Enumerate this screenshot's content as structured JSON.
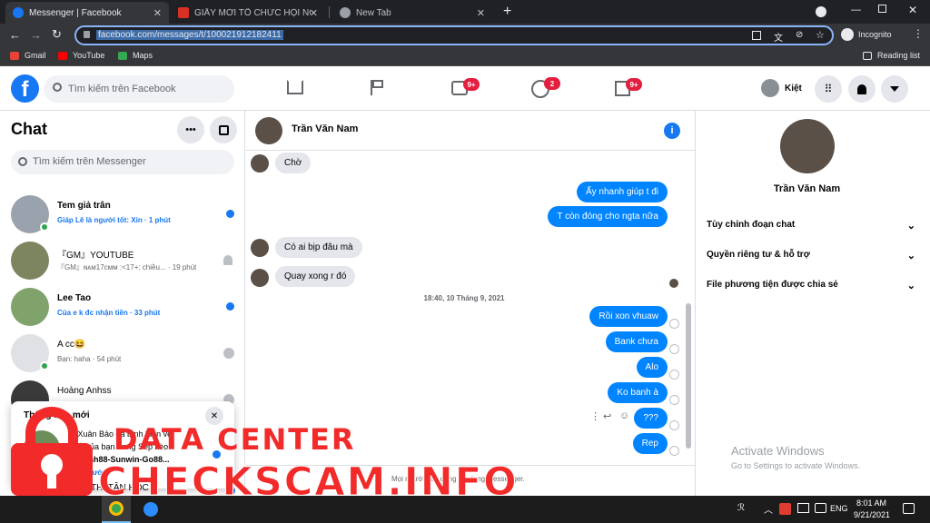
{
  "browser": {
    "tabs": [
      {
        "title": "Messenger | Facebook",
        "fav_color": "#1877f2"
      },
      {
        "title": "GIẤY MỜI TỔ CHỨC HỘI NGHỊ T...",
        "fav_color": "#d93025"
      },
      {
        "title": "New Tab",
        "fav_color": "#9aa0a6"
      }
    ],
    "url": "facebook.com/messages/t/100021912182411",
    "incognito_label": "Incognito",
    "bookmarks": [
      "Gmail",
      "YouTube",
      "Maps"
    ],
    "reading_list": "Reading list"
  },
  "fb": {
    "search_placeholder": "Tìm kiếm trên Facebook",
    "badges": {
      "watch": "9+",
      "groups": "2",
      "gaming": "9+"
    },
    "user_name": "Kiệt"
  },
  "chats": {
    "title": "Chat",
    "search_placeholder": "Tìm kiếm trên Messenger",
    "conversations": [
      {
        "name": "Tem giả trân",
        "preview": "Giáp Lê là người tốt: Xin · 1 phút",
        "unread": true
      },
      {
        "name": "『GM』YOUTUBE",
        "preview": "『GM』ɴᴀᴍ17ᴄᴍᴍ :<17+: chiều... · 19 phút",
        "unread": false
      },
      {
        "name": "Lee Tao",
        "preview": "Của e k đc nhận tiền · 33 phút",
        "unread": true
      },
      {
        "name": "A cc😆",
        "preview": "Bạn: haha · 54 phút",
        "unread": false
      },
      {
        "name": "Hoàng Anhss",
        "preview": "",
        "unread": false
      }
    ],
    "notification": {
      "title": "Thông báo mới",
      "line1": "6.Xuân Bảo đã bình luận về",
      "line2": "viết của bạn trong Sếp kèo",
      "line3": "...(Binh88-Sunwin-Go88...",
      "time": "...ày trước"
    },
    "last_item_partial": "THI TÂN HỌC"
  },
  "chat": {
    "contact_name": "Trần Văn Nam",
    "timestamp": "18:40, 10 Tháng 9, 2021",
    "messages_in": [
      "Chờ",
      "Có ai bịp đâu mà",
      "Quay xong r đó"
    ],
    "messages_out_before": [
      "Ấy nhanh giúp t đi",
      "T còn đóng cho ngta nữa"
    ],
    "messages_out_after": [
      "Rồi xon vhuaw",
      "Bank chưa",
      "Alo",
      "Ko banh à",
      "???",
      "Rep"
    ],
    "footer_note": "Mọi người này đang sử dụng Messenger."
  },
  "details": {
    "name": "Trần Văn Nam",
    "items": [
      "Tùy chỉnh đoạn chat",
      "Quyền riêng tư & hỗ trợ",
      "File phương tiện được chia sẻ"
    ]
  },
  "activate": {
    "line1": "Activate Windows",
    "line2": "Go to Settings to activate Windows."
  },
  "taskbar": {
    "lang": "ENG",
    "time": "8:01 AM",
    "date": "9/21/2021"
  },
  "watermark": {
    "line1": "DATA CENTER",
    "line2": "CHECKSCAM.INFO"
  },
  "colors": {
    "brand": "#1877f2",
    "bubble_out": "#0084ff",
    "watermark": "#f22a2a"
  }
}
